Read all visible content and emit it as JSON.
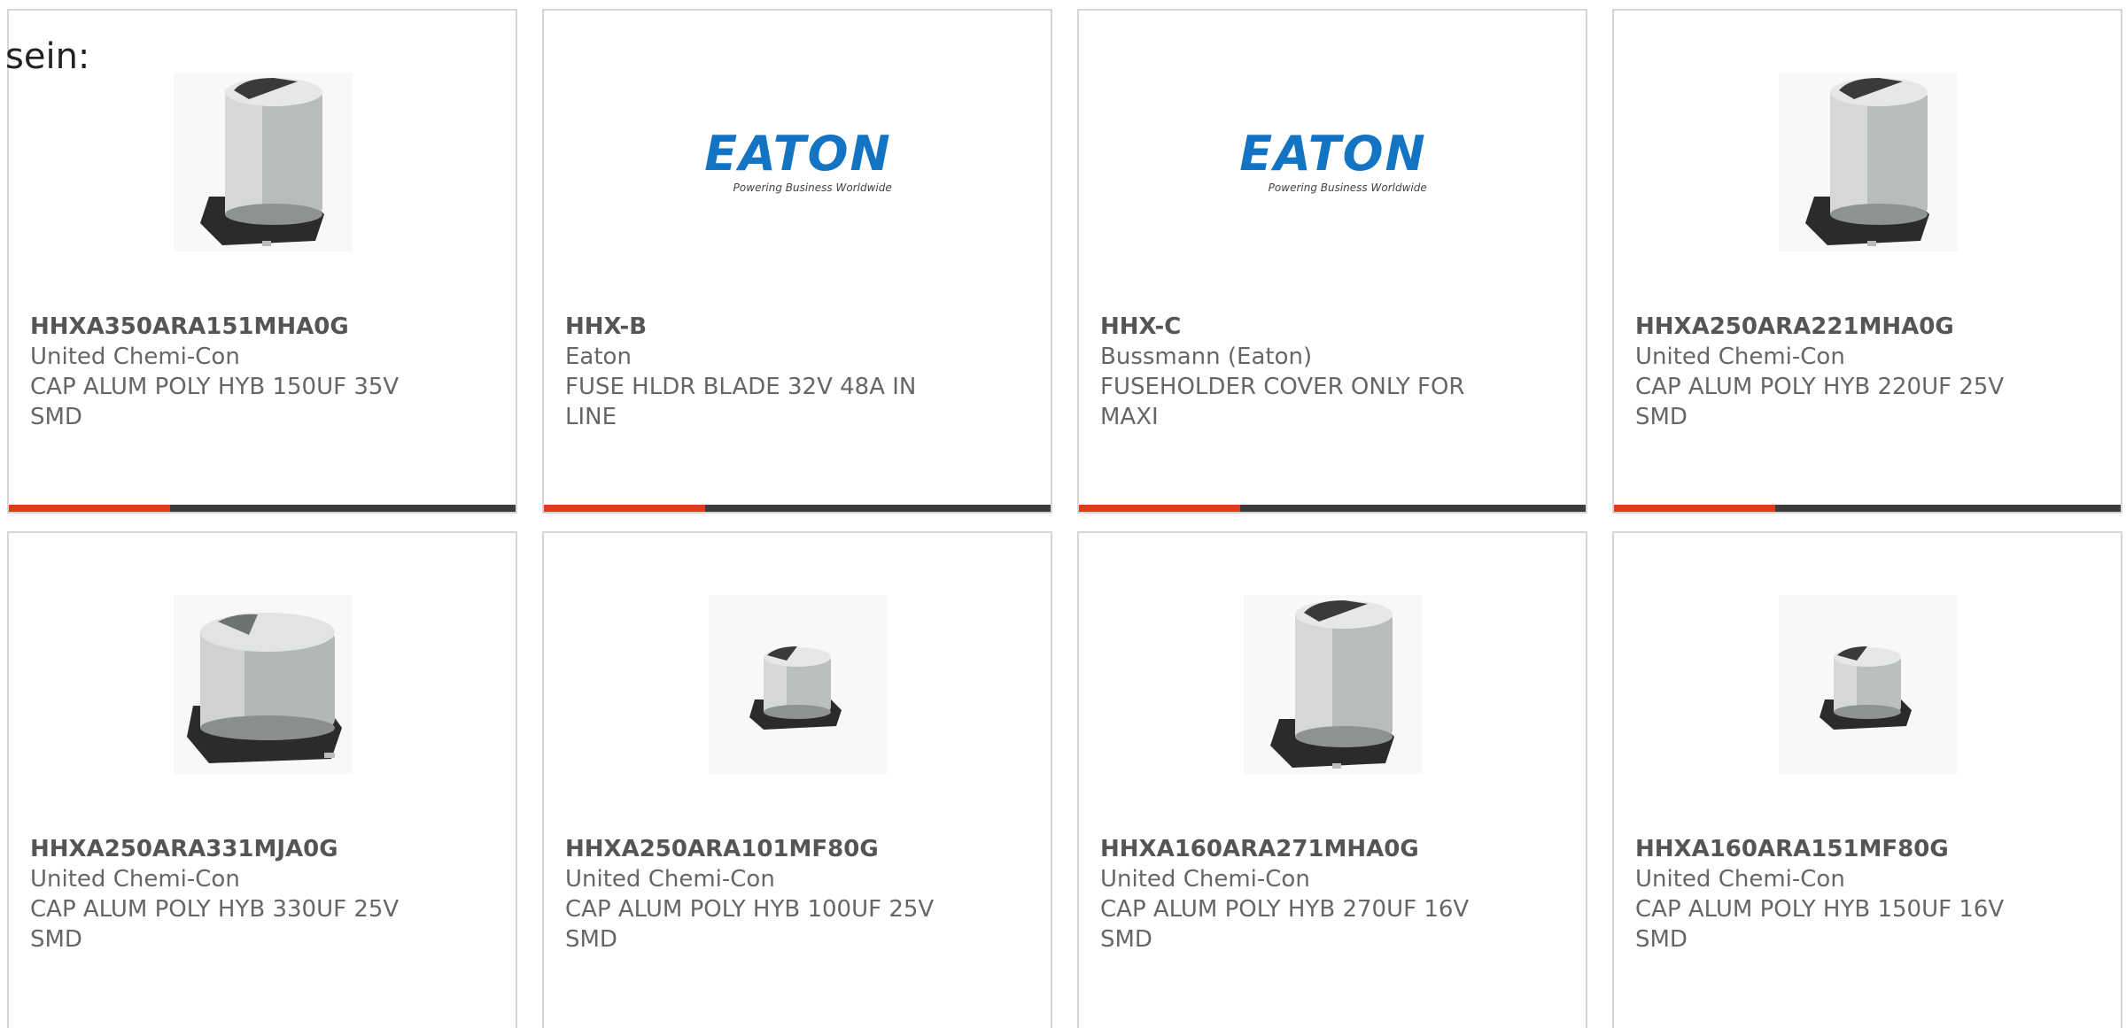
{
  "intro_text": "sein:",
  "colors": {
    "accent": "#e8381b",
    "bar": "#3c3c3c",
    "eaton_blue": "#1474c4"
  },
  "products": [
    {
      "part_number": "HHXA350ARA151MHA0G",
      "manufacturer": "United Chemi-Con",
      "description": "CAP ALUM POLY HYB 150UF 35V SMD",
      "image": "capacitor-large"
    },
    {
      "part_number": "HHX-B",
      "manufacturer": "Eaton",
      "description": "FUSE HLDR BLADE 32V 48A IN LINE",
      "image": "eaton-logo",
      "logo_text": "EATON",
      "logo_tagline": "Powering Business Worldwide"
    },
    {
      "part_number": "HHX-C",
      "manufacturer": "Bussmann (Eaton)",
      "description": "FUSEHOLDER COVER ONLY FOR MAXI",
      "image": "eaton-logo",
      "logo_text": "EATON",
      "logo_tagline": "Powering Business Worldwide"
    },
    {
      "part_number": "HHXA250ARA221MHA0G",
      "manufacturer": "United Chemi-Con",
      "description": "CAP ALUM POLY HYB 220UF 25V SMD",
      "image": "capacitor-large"
    },
    {
      "part_number": "HHXA250ARA331MJA0G",
      "manufacturer": "United Chemi-Con",
      "description": "CAP ALUM POLY HYB 330UF 25V SMD",
      "image": "capacitor-wide"
    },
    {
      "part_number": "HHXA250ARA101MF80G",
      "manufacturer": "United Chemi-Con",
      "description": "CAP ALUM POLY HYB 100UF 25V SMD",
      "image": "capacitor-small"
    },
    {
      "part_number": "HHXA160ARA271MHA0G",
      "manufacturer": "United Chemi-Con",
      "description": "CAP ALUM POLY HYB 270UF 16V SMD",
      "image": "capacitor-large"
    },
    {
      "part_number": "HHXA160ARA151MF80G",
      "manufacturer": "United Chemi-Con",
      "description": "CAP ALUM POLY HYB 150UF 16V SMD",
      "image": "capacitor-small"
    }
  ]
}
